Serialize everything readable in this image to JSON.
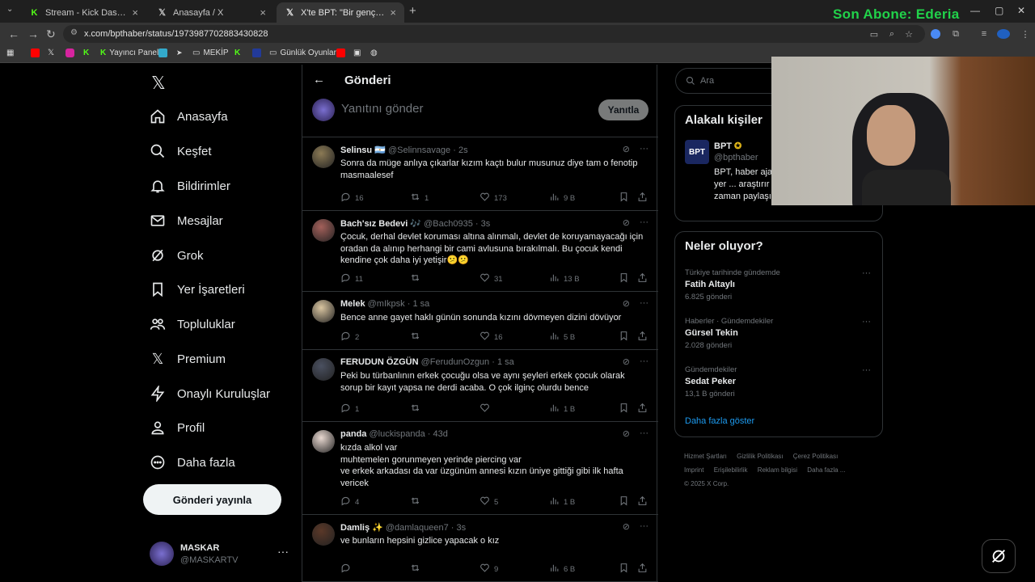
{
  "browser": {
    "tabs": [
      {
        "title": "Stream - Kick Dashboard",
        "icon": "kick-icon"
      },
      {
        "title": "Anasayfa / X",
        "icon": "x-icon"
      },
      {
        "title": "X'te BPT: \"Bir genç kız, annesi il...",
        "icon": "x-icon"
      }
    ],
    "url": "x.com/bpthaber/status/1973987702883430828",
    "bookmarks": [
      "Yayıncı Paneli",
      "MEKİP",
      "Günlük Oyunlar"
    ]
  },
  "stream_overlay": {
    "text": "Son Abone: Ederia"
  },
  "nav": {
    "items": [
      "Anasayfa",
      "Keşfet",
      "Bildirimler",
      "Mesajlar",
      "Grok",
      "Yer İşaretleri",
      "Topluluklar",
      "Premium",
      "Onaylı Kuruluşlar",
      "Profil",
      "Daha fazla"
    ],
    "post_button": "Gönderi yayınla",
    "user": {
      "name": "MASKAR",
      "handle": "@MASKARTV"
    }
  },
  "main": {
    "header_title": "Gönderi",
    "reply_placeholder": "Yanıtını gönder",
    "reply_button": "Yanıtla",
    "tweets": [
      {
        "name": "Selinsu 🇦🇷",
        "handle": "@Selinnsavage",
        "time": "· 2s",
        "text": "Sonra da müge anlıya çıkarlar kızım kaçtı bulur musunuz diye tam o fenotip masmaalesef",
        "replies": "16",
        "retweets": "1",
        "likes": "173",
        "views": "9 B"
      },
      {
        "name": "Bach'sız Bedevi 🎶",
        "handle": "@Bach0935",
        "time": "· 3s",
        "text": "Çocuk, derhal devlet koruması altına alınmalı, devlet de koruyamayacağı için oradan da alınıp herhangi bir cami avlusuna bırakılmalı. Bu çocuk kendi kendine çok daha iyi yetişir😕😕",
        "replies": "11",
        "retweets": "",
        "likes": "31",
        "views": "13 B"
      },
      {
        "name": "Melek",
        "handle": "@mIkpsk",
        "time": "· 1 sa",
        "text": "Bence anne gayet haklı günün sonunda kızını dövmeyen dizini dövüyor",
        "replies": "2",
        "retweets": "",
        "likes": "16",
        "views": "5 B"
      },
      {
        "name": "FERUDUN ÖZGÜN",
        "handle": "@FerudunOzgun",
        "time": "· 1 sa",
        "text": "Peki bu türbanlının erkek çocuğu olsa ve aynı şeyleri erkek çocuk olarak sorup bir kayıt yapsa ne derdi acaba. O çok ilginç olurdu bence",
        "replies": "1",
        "retweets": "",
        "likes": "",
        "views": "1 B"
      },
      {
        "name": "panda",
        "handle": "@luckispanda",
        "time": "· 43d",
        "text": "kızda alkol var\nmuhtemelen gorunmeyen yerinde piercing var\nve erkek arkadası da var üzgünüm annesi kızın üniye gittiği gibi ilk hafta vericek",
        "replies": "4",
        "retweets": "",
        "likes": "5",
        "views": "1 B"
      },
      {
        "name": "Damliş ✨",
        "handle": "@damlaqueen7",
        "time": "· 3s",
        "text": "ve bunların hepsini gizlice yapacak o kız",
        "replies": "",
        "retweets": "",
        "likes": "9",
        "views": "6 B"
      }
    ]
  },
  "sidebar": {
    "search_placeholder": "Ara",
    "related_title": "Alakalı kişiler",
    "related_person": {
      "name": "BPT",
      "handle": "@bpthaber",
      "bio": "BPT, haber aja... internette yer ... araştırır ve doğ... zaman paylaşır. info@bpt.tr"
    },
    "trends_title": "Neler oluyor?",
    "trends": [
      {
        "category": "Türkiye tarihinde gündemde",
        "name": "Fatih Altaylı",
        "count": "6.825 gönderi"
      },
      {
        "category": "Haberler · Gündemdekiler",
        "name": "Gürsel Tekin",
        "count": "2.028 gönderi"
      },
      {
        "category": "Gündemdekiler",
        "name": "Sedat Peker",
        "count": "13,1 B gönderi"
      }
    ],
    "show_more": "Daha fazla göster",
    "footer_line1": [
      "Hizmet Şartları",
      "Gizlilik Politikası",
      "Çerez Politikası"
    ],
    "footer_line2": [
      "Imprint",
      "Erişilebilirlik",
      "Reklam bilgisi",
      "Daha fazla ..."
    ],
    "copyright": "© 2025 X Corp."
  },
  "colors": {
    "accent": "#1d9bf0",
    "overlay_green": "#21d24a",
    "verified_gold": "#e2b719"
  }
}
